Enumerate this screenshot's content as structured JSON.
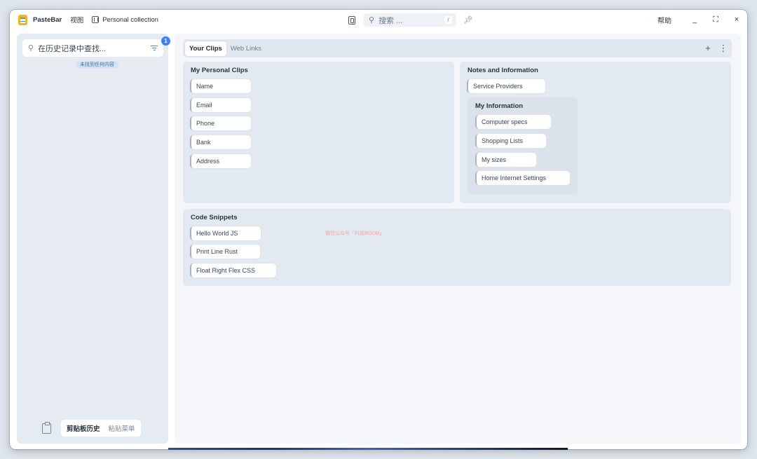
{
  "titlebar": {
    "app_name": "PasteBar",
    "menu_view": "视图",
    "collection_name": "Personal collection",
    "search_placeholder": "搜索 ...",
    "search_shortcut": "/",
    "help": "帮助",
    "minimize": "_",
    "maximize": "⛶",
    "close": "×"
  },
  "sidebar": {
    "search_placeholder": "在历史记录中查找...",
    "filter_badge": "1",
    "empty_text": "未找到任何内容",
    "footer": {
      "tab_history": "剪贴板历史",
      "tab_menu": "粘贴菜单"
    }
  },
  "main": {
    "tabs": [
      {
        "label": "Your Clips",
        "active": true
      },
      {
        "label": "Web Links",
        "active": false
      }
    ],
    "add_label": "+",
    "more_label": "⋮",
    "boards": {
      "personal": {
        "title": "My Personal Clips",
        "clips": [
          "Name",
          "Email",
          "Phone",
          "Bank",
          "Address"
        ]
      },
      "notes": {
        "title": "Notes and Information",
        "clips": [
          "Service Providers"
        ],
        "sub_board": {
          "title": "My Information",
          "clips": [
            "Computer specs",
            "Shopping Lists",
            "My sizes",
            "Home Internet Settings"
          ]
        }
      },
      "code": {
        "title": "Code Snippets",
        "clips": [
          "Hello World JS",
          "Print Line Rust",
          "Float Right Flex CSS"
        ]
      }
    },
    "watermark": "微信公众号「科技BOOM」"
  },
  "colors": {
    "accent": "#3b82f6",
    "logo": "#f5b324",
    "board_bg": "#e3e9f1",
    "sidebar_bg": "#e6ebf2"
  }
}
